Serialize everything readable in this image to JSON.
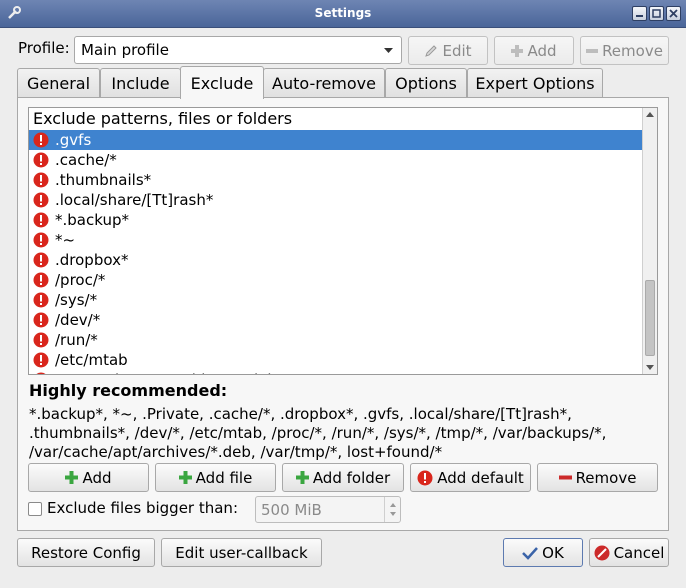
{
  "window": {
    "title": "Settings"
  },
  "profile": {
    "label": "Profile:",
    "selected": "Main profile",
    "edit_label": "Edit",
    "add_label": "Add",
    "remove_label": "Remove"
  },
  "tabs": [
    "General",
    "Include",
    "Exclude",
    "Auto-remove",
    "Options",
    "Expert Options"
  ],
  "active_tab": "Exclude",
  "exclude_list": {
    "header": "Exclude patterns, files or folders",
    "items": [
      ".gvfs",
      ".cache/*",
      ".thumbnails*",
      ".local/share/[Tt]rash*",
      "*.backup*",
      "*~",
      ".dropbox*",
      "/proc/*",
      "/sys/*",
      "/dev/*",
      "/run/*",
      "/etc/mtab",
      "/var/cache/apt/archives/*.deb"
    ],
    "selected_index": 0
  },
  "recommended": {
    "title": "Highly recommended:",
    "text": "*.backup*, *~, .Private, .cache/*, .dropbox*, .gvfs, .local/share/[Tt]rash*, .thumbnails*, /dev/*, /etc/mtab, /proc/*, /run/*, /sys/*, /tmp/*, /var/backups/*, /var/cache/apt/archives/*.deb, /var/tmp/*, lost+found/*"
  },
  "actions": {
    "add": "Add",
    "add_file": "Add file",
    "add_folder": "Add folder",
    "add_default": "Add default",
    "remove": "Remove"
  },
  "size_filter": {
    "label": "Exclude files bigger than:",
    "value": "500 MiB",
    "checked": false
  },
  "footer": {
    "restore": "Restore Config",
    "edit_callback": "Edit user-callback",
    "ok": "OK",
    "cancel": "Cancel"
  },
  "colors": {
    "titlebar": "#4a6599",
    "selection": "#3f83cf",
    "warning": "#d9261c",
    "add_green": "#3aa640",
    "remove_red": "#cc2a2a"
  },
  "icons": {
    "item": "warning-icon",
    "add": "plus-icon",
    "remove": "minus-icon",
    "edit": "pencil-icon",
    "ok": "check-icon",
    "cancel": "cancel-icon"
  }
}
